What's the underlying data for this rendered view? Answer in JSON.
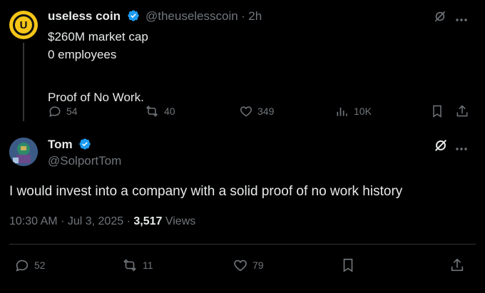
{
  "parent": {
    "display_name": "useless coin",
    "handle": "@theuselesscoin",
    "separator": "·",
    "time": "2h",
    "lines": [
      "$260M market cap",
      "0 employees",
      "",
      "Proof of No Work."
    ],
    "stats": {
      "replies": "54",
      "reposts": "40",
      "likes": "349",
      "views": "10K"
    },
    "avatar_letter": "U"
  },
  "reply": {
    "display_name": "Tom",
    "handle": "@SolportTom",
    "text": "I would invest into a company with a solid proof of no work history",
    "time": "10:30 AM",
    "date": "Jul 3, 2025",
    "views_count": "3,517",
    "views_label": "Views",
    "dot": "·",
    "stats": {
      "replies": "52",
      "reposts": "11",
      "likes": "79"
    }
  },
  "colors": {
    "verified": "#1d9bf0",
    "avatar_yellow": "#f5c518",
    "muted": "#71767b",
    "text": "#e7e9ea"
  }
}
